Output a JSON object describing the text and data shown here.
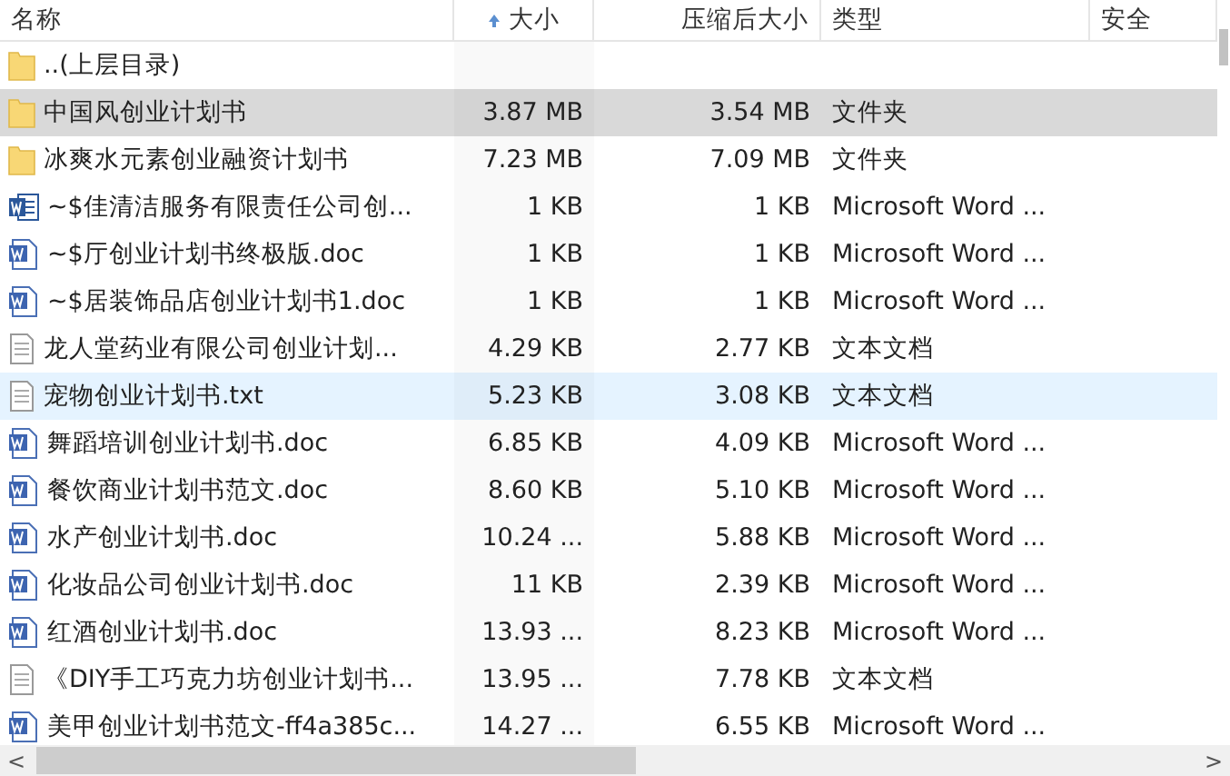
{
  "columns": [
    {
      "label": "名称",
      "sorted": false
    },
    {
      "label": "大小",
      "sorted": true
    },
    {
      "label": "压缩后大小",
      "sorted": false
    },
    {
      "label": "类型",
      "sorted": false
    },
    {
      "label": "安全",
      "sorted": false
    }
  ],
  "rows": [
    {
      "kind": "folder",
      "name": "..(上层目录)",
      "selected": false,
      "hover": false
    },
    {
      "kind": "folder",
      "name": "中国风创业计划书",
      "size": "3.87 MB",
      "packed": "3.54 MB",
      "type": "文件夹",
      "selected": true,
      "hover": false
    },
    {
      "kind": "folder",
      "name": "冰爽水元素创业融资计划书",
      "size": "7.23 MB",
      "packed": "7.09 MB",
      "type": "文件夹",
      "selected": false,
      "hover": false
    },
    {
      "kind": "word-new",
      "name": "~$佳清洁服务有限责任公司创...",
      "size": "1 KB",
      "packed": "1 KB",
      "type": "Microsoft Word ...",
      "selected": false,
      "hover": false
    },
    {
      "kind": "word",
      "name": "~$厅创业计划书终极版.doc",
      "size": "1 KB",
      "packed": "1 KB",
      "type": "Microsoft Word ...",
      "selected": false,
      "hover": false
    },
    {
      "kind": "word",
      "name": "~$居装饰品店创业计划书1.doc",
      "size": "1 KB",
      "packed": "1 KB",
      "type": "Microsoft Word ...",
      "selected": false,
      "hover": false
    },
    {
      "kind": "text",
      "name": "龙人堂药业有限公司创业计划...",
      "size": "4.29 KB",
      "packed": "2.77 KB",
      "type": "文本文档",
      "selected": false,
      "hover": false
    },
    {
      "kind": "text",
      "name": "宠物创业计划书.txt",
      "size": "5.23 KB",
      "packed": "3.08 KB",
      "type": "文本文档",
      "selected": false,
      "hover": true
    },
    {
      "kind": "word",
      "name": "舞蹈培训创业计划书.doc",
      "size": "6.85 KB",
      "packed": "4.09 KB",
      "type": "Microsoft Word ...",
      "selected": false,
      "hover": false
    },
    {
      "kind": "word",
      "name": "餐饮商业计划书范文.doc",
      "size": "8.60 KB",
      "packed": "5.10 KB",
      "type": "Microsoft Word ...",
      "selected": false,
      "hover": false
    },
    {
      "kind": "word",
      "name": "水产创业计划书.doc",
      "size": "10.24 ...",
      "packed": "5.88 KB",
      "type": "Microsoft Word ...",
      "selected": false,
      "hover": false
    },
    {
      "kind": "word",
      "name": "化妆品公司创业计划书.doc",
      "size": "11 KB",
      "packed": "2.39 KB",
      "type": "Microsoft Word ...",
      "selected": false,
      "hover": false
    },
    {
      "kind": "word",
      "name": "红酒创业计划书.doc",
      "size": "13.93 ...",
      "packed": "8.23 KB",
      "type": "Microsoft Word ...",
      "selected": false,
      "hover": false
    },
    {
      "kind": "text",
      "name": "《DIY手工巧克力坊创业计划书...",
      "size": "13.95 ...",
      "packed": "7.78 KB",
      "type": "文本文档",
      "selected": false,
      "hover": false
    },
    {
      "kind": "word",
      "name": "美甲创业计划书范文-ff4a385c...",
      "size": "14.27 ...",
      "packed": "6.55 KB",
      "type": "Microsoft Word ...",
      "selected": false,
      "hover": false
    }
  ],
  "scrollbar": {
    "left": "<",
    "right": ">"
  }
}
